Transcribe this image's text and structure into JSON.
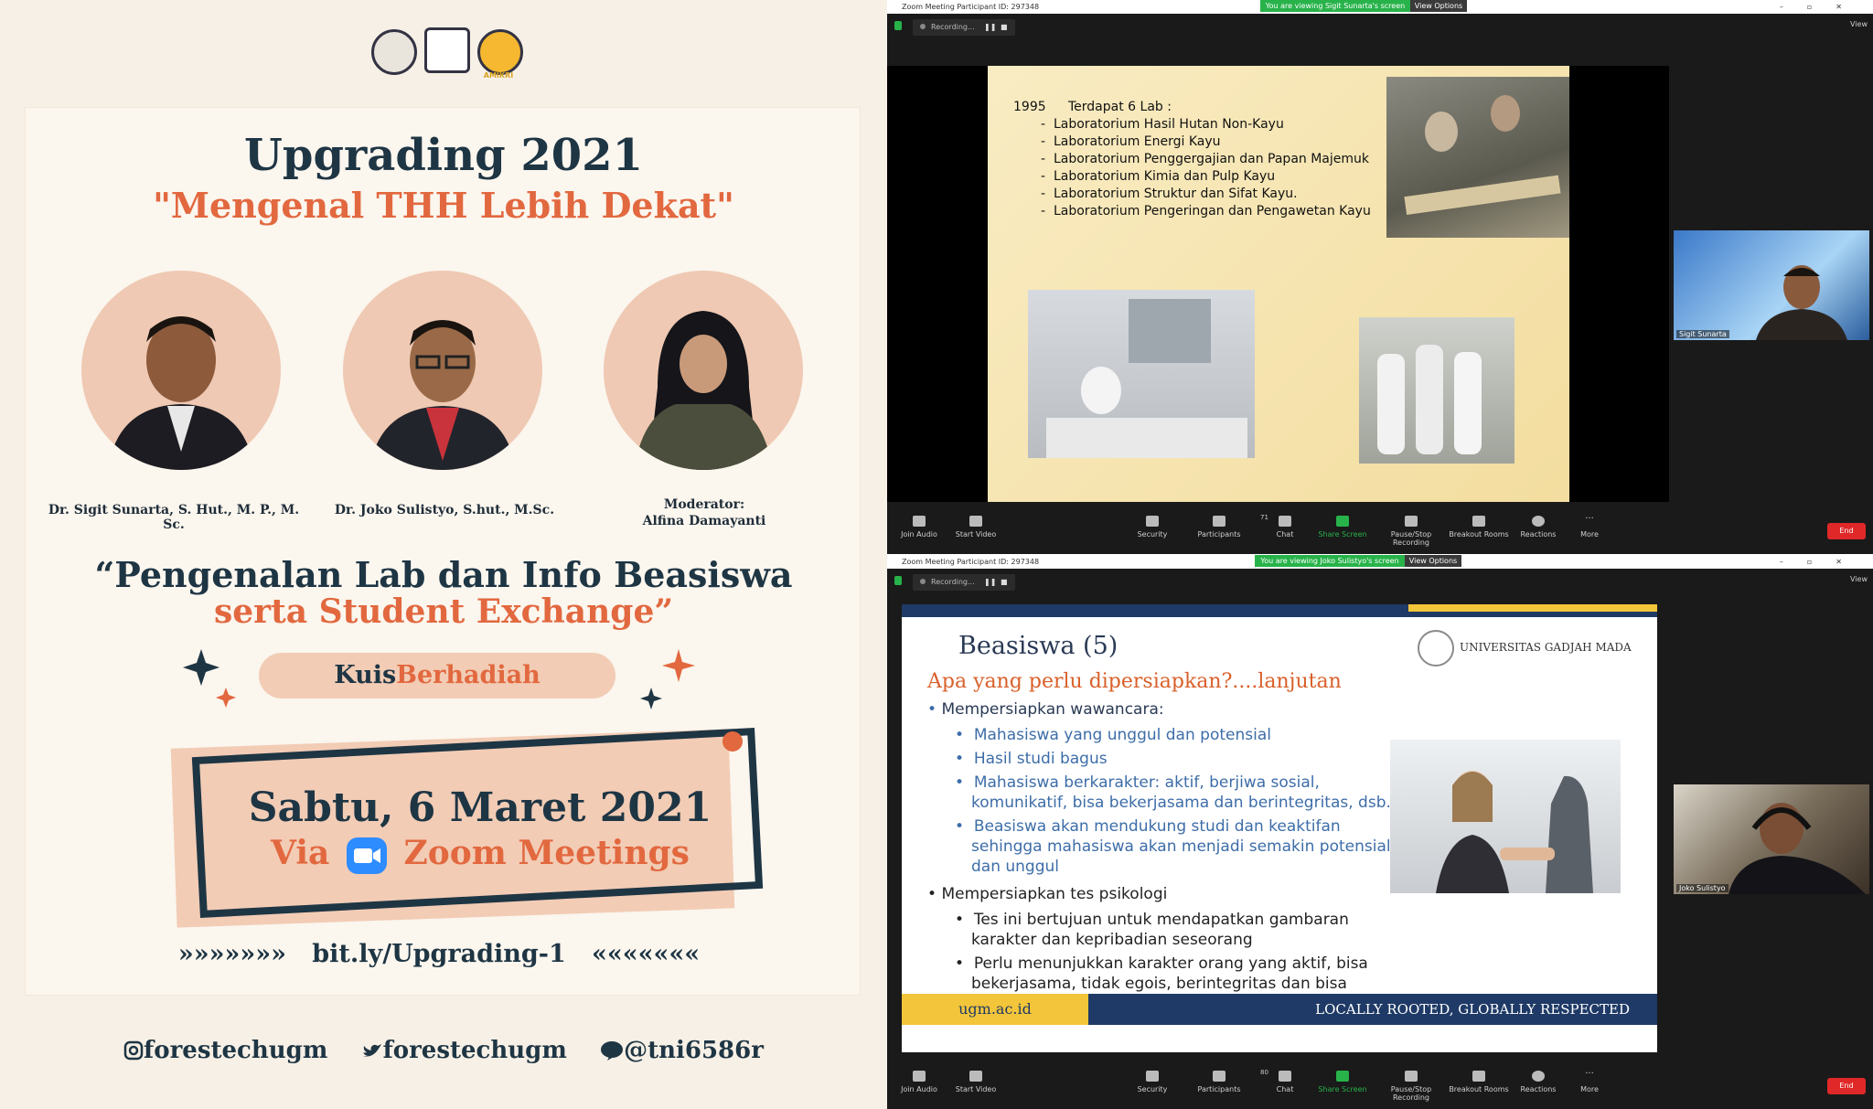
{
  "poster": {
    "title": "Upgrading 2021",
    "subtitle": "\"Mengenal THH Lebih Dekat\"",
    "speakers": [
      {
        "name": "Dr. Sigit Sunarta, S. Hut., M. P., M. Sc."
      },
      {
        "name": "Dr. Joko Sulistyo, S.hut., M.Sc."
      },
      {
        "role": "Moderator:",
        "name": "Alfina Damayanti"
      }
    ],
    "topic_line1": "“Pengenalan Lab dan Info Beasiswa",
    "topic_line2": "serta Student Exchange”",
    "quiz_a": "Kuis",
    "quiz_b": "Berhadiah",
    "date": "Sabtu, 6 Maret 2021",
    "via": "Via",
    "platform": "Zoom Meetings",
    "arrows_left": "»»»»»»»",
    "link": "bit.ly/Upgrading-1",
    "arrows_right": "«««««««",
    "instagram": "forestechugm",
    "twitter": "forestechugm",
    "line": "@tni6586r",
    "logo_label": "AMIKRI"
  },
  "colors": {
    "navy": "#1e3544",
    "orange": "#e2683f",
    "peach": "#f2ccb5",
    "zoom_green": "#28b34a",
    "zoom_end": "#e02828",
    "zoom_blue": "#2d8cff"
  },
  "zoom_windows": [
    {
      "title": "Zoom Meeting Participant ID: 297348",
      "viewing": "You are viewing Sigit Sunarta's screen",
      "view_options": "View Options",
      "recording": "Recording...",
      "view": "View",
      "thumb_name": "Sigit Sunarta",
      "slide": {
        "year": "1995",
        "heading": "Terdapat 6 Lab :",
        "items": [
          "Laboratorium Hasil Hutan Non-Kayu",
          "Laboratorium Energi Kayu",
          "Laboratorium Penggergajian dan Papan Majemuk",
          "Laboratorium Kimia dan Pulp Kayu",
          "Laboratorium Struktur dan Sifat Kayu.",
          "Laboratorium Pengeringan dan Pengawetan  Kayu"
        ]
      },
      "participants_count": "71"
    },
    {
      "title": "Zoom Meeting Participant ID: 297348",
      "viewing": "You are viewing Joko Sulistyo's screen",
      "view_options": "View Options",
      "recording": "Recording...",
      "view": "View",
      "thumb_name": "Joko Sulistyo",
      "slide": {
        "title": "Beasiswa (5)",
        "university": "UNIVERSITAS GADJAH MADA",
        "subtitle": "Apa yang perlu dipersiapkan?....lanjutan",
        "b1": "Mempersiapkan wawancara:",
        "b1_items": [
          "Mahasiswa yang unggul dan potensial",
          "Hasil studi bagus",
          "Mahasiswa berkarakter: aktif, berjiwa sosial, komunikatif, bisa bekerjasama dan berintegritas, dsb.",
          "Beasiswa akan mendukung studi dan keaktifan sehingga mahasiswa akan menjadi semakin potensial dan unggul"
        ],
        "b2": "Mempersiapkan tes psikologi",
        "b2_items": [
          "Tes ini bertujuan untuk mendapatkan gambaran karakter dan kepribadian seseorang",
          "Perlu menunjukkan karakter orang yang aktif, bisa bekerjasama, tidak egois, berintegritas dan bisa dipercaya, dsb"
        ],
        "footer_url": "ugm.ac.id",
        "footer_tagline": "LOCALLY ROOTED, GLOBALLY RESPECTED"
      },
      "participants_count": "80"
    }
  ],
  "toolbar": {
    "join_audio": "Join Audio",
    "start_video": "Start Video",
    "security": "Security",
    "participants": "Participants",
    "chat": "Chat",
    "share_screen": "Share Screen",
    "pause_recording": "Pause/Stop Recording",
    "breakout": "Breakout Rooms",
    "reactions": "Reactions",
    "more": "More",
    "end": "End"
  }
}
